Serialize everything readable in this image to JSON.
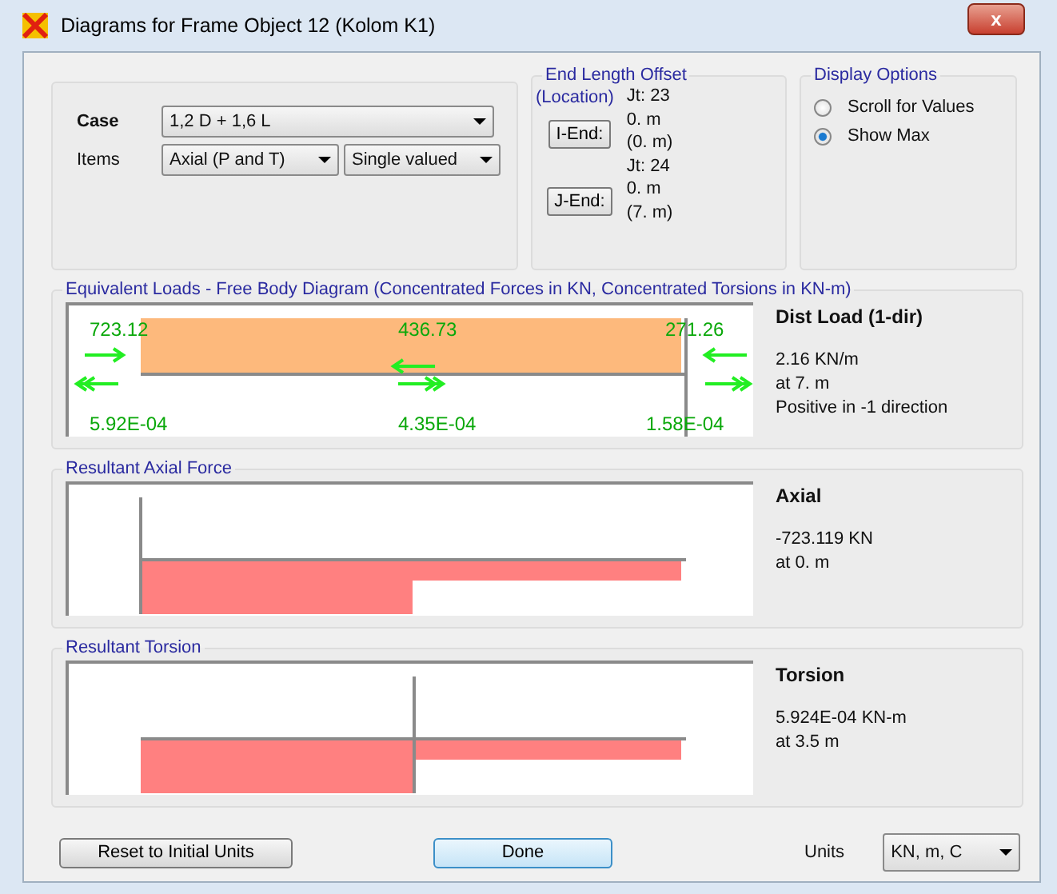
{
  "window": {
    "title": "Diagrams for Frame Object 12  (Kolom K1)",
    "close": "x"
  },
  "case": {
    "label": "Case",
    "value": "1,2 D + 1,6 L"
  },
  "items": {
    "label": "Items",
    "component": "Axial (P and T)",
    "mode": "Single valued"
  },
  "end_offset": {
    "title": "End Length Offset",
    "subtitle": "(Location)",
    "ends": [
      {
        "button": "I-End:",
        "joint": "Jt:  23",
        "offset": "0. m",
        "location": "(0. m)"
      },
      {
        "button": "J-End:",
        "joint": "Jt:  24",
        "offset": "0. m",
        "location": "(7. m)"
      }
    ]
  },
  "display_options": {
    "title": "Display Options",
    "options": [
      {
        "label": "Scroll for Values",
        "selected": false
      },
      {
        "label": "Show Max",
        "selected": true
      }
    ]
  },
  "free_body": {
    "title": "Equivalent Loads - Free Body Diagram  (Concentrated Forces in KN, Concentrated Torsions in KN-m)",
    "forces": [
      "723.12",
      "436.73",
      "271.26"
    ],
    "torsions": [
      "5.92E-04",
      "4.35E-04",
      "1.58E-04"
    ],
    "heading": "Dist Load (1-dir)",
    "lines": [
      "2.16 KN/m",
      "at 7. m",
      "Positive in -1 direction"
    ]
  },
  "axial": {
    "title": "Resultant Axial Force",
    "heading": "Axial",
    "lines": [
      "-723.119 KN",
      "at 0. m"
    ]
  },
  "torsion": {
    "title": "Resultant Torsion",
    "heading": "Torsion",
    "lines": [
      "5.924E-04 KN-m",
      "at 3.5 m"
    ]
  },
  "buttons": {
    "reset": "Reset to Initial Units",
    "done": "Done"
  },
  "units": {
    "label": "Units",
    "value": "KN, m, C"
  }
}
